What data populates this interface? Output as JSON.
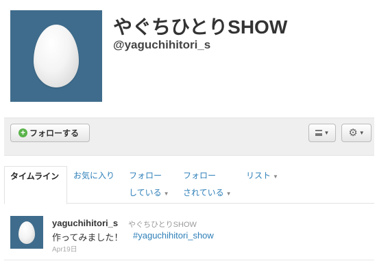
{
  "profile": {
    "name": "やぐちひとりSHOW",
    "handle": "@yaguchihitori_s"
  },
  "actions": {
    "follow_label": "フォローする"
  },
  "tabs": [
    {
      "label": "タイムライン",
      "active": true
    },
    {
      "label": "お気に入り"
    },
    {
      "label_line1": "フォロー",
      "label_line2": "している"
    },
    {
      "label_line1": "フォロー",
      "label_line2": "されている"
    },
    {
      "label": "リスト"
    }
  ],
  "tweet": {
    "username": "yaguchihitori_s",
    "display_name": "やぐちひとりSHOW",
    "text": "作ってみました！",
    "hashtag": "#yaguchihitori_show",
    "date": "Apr19日"
  },
  "colors": {
    "avatar_bg": "#3f6c8c",
    "link": "#2d7fb8",
    "follow_icon": "#5ab34a"
  },
  "icons": [
    "egg-avatar",
    "plus-icon",
    "list-icon",
    "gear-icon",
    "caret-down-icon"
  ]
}
